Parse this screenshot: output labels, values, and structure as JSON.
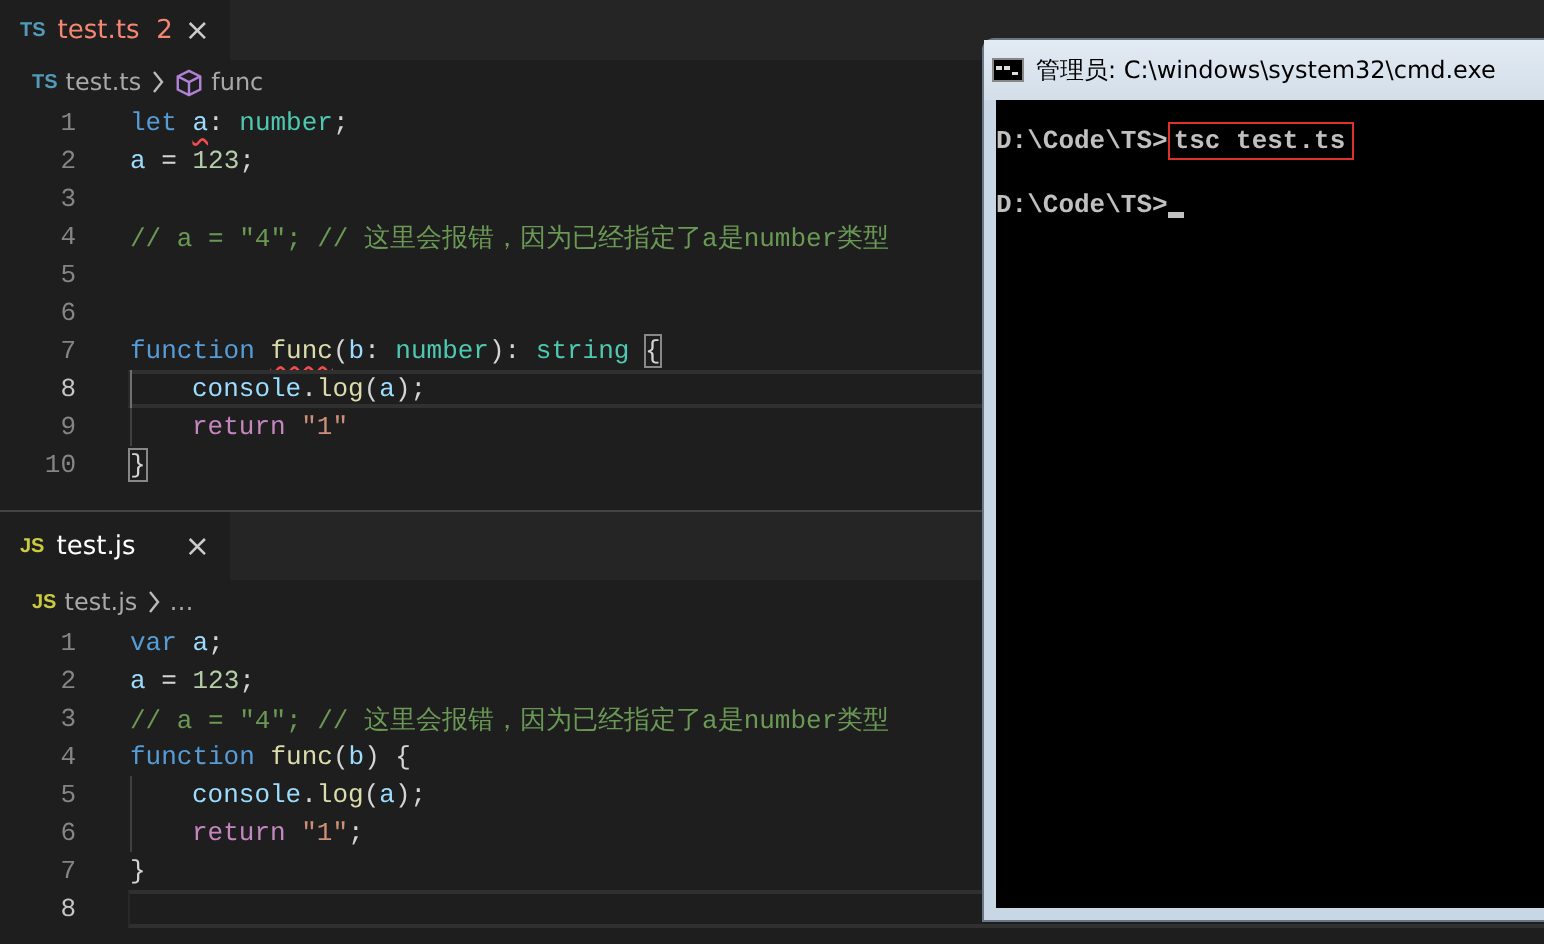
{
  "editors": [
    {
      "tab": {
        "lang": "TS",
        "name": "test.ts",
        "problems": "2",
        "has_errors": true,
        "close": "×"
      },
      "breadcrumb": {
        "lang": "TS",
        "file": "test.ts",
        "symbol": "func",
        "symbol_icon": true
      },
      "lines": [
        {
          "number": "1",
          "active": false,
          "indented": false,
          "tokens": [
            {
              "t": "let ",
              "kind": "keyword"
            },
            {
              "t": "a",
              "kind": "variable",
              "error": true
            },
            {
              "t": ": ",
              "kind": "plain"
            },
            {
              "t": "number",
              "kind": "type"
            },
            {
              "t": ";",
              "kind": "plain"
            }
          ]
        },
        {
          "number": "2",
          "active": false,
          "indented": false,
          "tokens": [
            {
              "t": "a",
              "kind": "variable"
            },
            {
              "t": " = ",
              "kind": "plain"
            },
            {
              "t": "123",
              "kind": "number"
            },
            {
              "t": ";",
              "kind": "plain"
            }
          ]
        },
        {
          "number": "3",
          "active": false,
          "indented": false
        },
        {
          "number": "4",
          "active": false,
          "indented": false,
          "tokens": [
            {
              "t": "// a = \"4\"; // 这里会报错，因为已经指定了a是number类型",
              "kind": "comment"
            }
          ]
        },
        {
          "number": "5",
          "active": false,
          "indented": false
        },
        {
          "number": "6",
          "active": false,
          "indented": false
        },
        {
          "number": "7",
          "active": false,
          "indented": false,
          "tokens": [
            {
              "t": "function ",
              "kind": "keyword"
            },
            {
              "t": "func",
              "kind": "function",
              "error": true
            },
            {
              "t": "(",
              "kind": "plain"
            },
            {
              "t": "b",
              "kind": "variable"
            },
            {
              "t": ": ",
              "kind": "plain"
            },
            {
              "t": "number",
              "kind": "type"
            },
            {
              "t": "): ",
              "kind": "plain"
            },
            {
              "t": "string ",
              "kind": "type"
            },
            {
              "t": "{",
              "kind": "plain",
              "matched": true
            }
          ]
        },
        {
          "number": "8",
          "active": true,
          "indented": true,
          "tokens": [
            {
              "t": "console",
              "kind": "variable"
            },
            {
              "t": ".",
              "kind": "plain"
            },
            {
              "t": "log",
              "kind": "function"
            },
            {
              "t": "(",
              "kind": "plain"
            },
            {
              "t": "a",
              "kind": "variable"
            },
            {
              "t": ");",
              "kind": "plain"
            }
          ]
        },
        {
          "number": "9",
          "active": false,
          "indented": true,
          "tokens": [
            {
              "t": "return ",
              "kind": "control"
            },
            {
              "t": "\"1\"",
              "kind": "string"
            }
          ]
        },
        {
          "number": "10",
          "active": false,
          "indented": false,
          "tokens": [
            {
              "t": "}",
              "kind": "plain",
              "matched": true
            }
          ]
        }
      ]
    },
    {
      "tab": {
        "lang": "JS",
        "name": "test.js",
        "has_errors": false,
        "close": "×"
      },
      "breadcrumb": {
        "lang": "JS",
        "file": "test.js",
        "symbol": "…",
        "symbol_icon": false
      },
      "lines": [
        {
          "number": "1",
          "active": false,
          "indented": false,
          "tokens": [
            {
              "t": "var ",
              "kind": "keyword"
            },
            {
              "t": "a",
              "kind": "variable"
            },
            {
              "t": ";",
              "kind": "plain"
            }
          ]
        },
        {
          "number": "2",
          "active": false,
          "indented": false,
          "tokens": [
            {
              "t": "a",
              "kind": "variable"
            },
            {
              "t": " = ",
              "kind": "plain"
            },
            {
              "t": "123",
              "kind": "number"
            },
            {
              "t": ";",
              "kind": "plain"
            }
          ]
        },
        {
          "number": "3",
          "active": false,
          "indented": false,
          "tokens": [
            {
              "t": "// a = \"4\"; // 这里会报错，因为已经指定了a是number类型",
              "kind": "comment"
            }
          ]
        },
        {
          "number": "4",
          "active": false,
          "indented": false,
          "tokens": [
            {
              "t": "function ",
              "kind": "keyword"
            },
            {
              "t": "func",
              "kind": "function"
            },
            {
              "t": "(",
              "kind": "plain"
            },
            {
              "t": "b",
              "kind": "variable"
            },
            {
              "t": ") {",
              "kind": "plain"
            }
          ]
        },
        {
          "number": "5",
          "active": false,
          "indented": true,
          "tokens": [
            {
              "t": "console",
              "kind": "variable"
            },
            {
              "t": ".",
              "kind": "plain"
            },
            {
              "t": "log",
              "kind": "function"
            },
            {
              "t": "(",
              "kind": "plain"
            },
            {
              "t": "a",
              "kind": "variable"
            },
            {
              "t": ");",
              "kind": "plain"
            }
          ]
        },
        {
          "number": "6",
          "active": false,
          "indented": true,
          "tokens": [
            {
              "t": "return ",
              "kind": "control"
            },
            {
              "t": "\"1\"",
              "kind": "string"
            },
            {
              "t": ";",
              "kind": "plain"
            }
          ]
        },
        {
          "number": "7",
          "active": false,
          "indented": false,
          "tokens": [
            {
              "t": "}",
              "kind": "plain"
            }
          ]
        },
        {
          "number": "8",
          "active": true,
          "indented": false
        }
      ]
    }
  ],
  "console_window": {
    "title": "管理员: C:\\windows\\system32\\cmd.exe",
    "lines": [
      {
        "prompt": "D:\\Code\\TS>",
        "command": "tsc test.ts",
        "highlighted": true,
        "cursor": false
      },
      {
        "prompt": "D:\\Code\\TS>",
        "cursor": true
      }
    ]
  }
}
